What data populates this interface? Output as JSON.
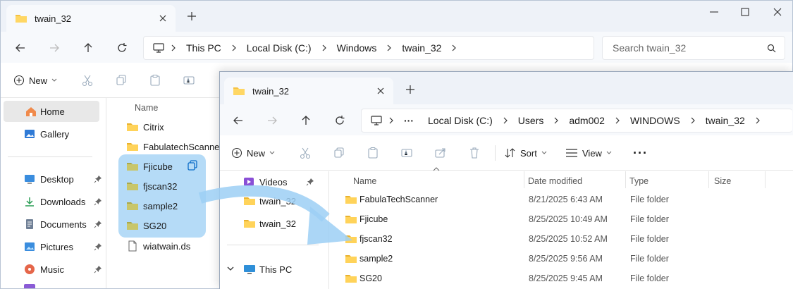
{
  "back_window": {
    "tab_title": "twain_32",
    "breadcrumb": [
      "This PC",
      "Local Disk (C:)",
      "Windows",
      "twain_32"
    ],
    "search_placeholder": "Search twain_32",
    "toolbar": {
      "new_label": "New"
    },
    "nav": [
      {
        "label": "Home",
        "icon": "home-icon",
        "pinned": false
      },
      {
        "label": "Gallery",
        "icon": "gallery-icon",
        "pinned": false
      },
      {
        "label": "Desktop",
        "icon": "desktop-icon",
        "pinned": true
      },
      {
        "label": "Downloads",
        "icon": "download-icon",
        "pinned": true
      },
      {
        "label": "Documents",
        "icon": "documents-icon",
        "pinned": true
      },
      {
        "label": "Pictures",
        "icon": "pictures-icon",
        "pinned": true
      },
      {
        "label": "Music",
        "icon": "music-icon",
        "pinned": true
      }
    ],
    "column_name": "Name",
    "files": [
      {
        "name": "Citrix",
        "type": "folder",
        "selected": false
      },
      {
        "name": "FabulatechScanner",
        "type": "folder",
        "selected": false
      },
      {
        "name": "Fjicube",
        "type": "folder",
        "selected": true
      },
      {
        "name": "fjscan32",
        "type": "folder",
        "selected": true
      },
      {
        "name": "sample2",
        "type": "folder",
        "selected": true
      },
      {
        "name": "SG20",
        "type": "folder",
        "selected": true
      },
      {
        "name": "wiatwain.ds",
        "type": "file",
        "selected": false
      }
    ]
  },
  "front_window": {
    "tab_title": "twain_32",
    "breadcrumb": [
      "···",
      "Local Disk (C:)",
      "Users",
      "adm002",
      "WINDOWS",
      "twain_32"
    ],
    "toolbar": {
      "new_label": "New",
      "sort_label": "Sort",
      "view_label": "View",
      "more_label": "···"
    },
    "nav": [
      {
        "label": "Videos",
        "icon": "videos-icon",
        "pinned": true
      },
      {
        "label": "twain_32",
        "icon": "folder-icon",
        "pinned": false
      },
      {
        "label": "twain_32",
        "icon": "folder-icon",
        "pinned": false
      },
      {
        "label": "This PC",
        "icon": "this-pc-icon",
        "pinned": false,
        "expanded": true
      }
    ],
    "columns": [
      "Name",
      "Date modified",
      "Type",
      "Size"
    ],
    "files": [
      {
        "name": "FabulaTechScanner",
        "date": "8/21/2025 6:43 AM",
        "type": "File folder",
        "size": ""
      },
      {
        "name": "Fjicube",
        "date": "8/25/2025 10:49 AM",
        "type": "File folder",
        "size": ""
      },
      {
        "name": "fjscan32",
        "date": "8/25/2025 10:52 AM",
        "type": "File folder",
        "size": ""
      },
      {
        "name": "sample2",
        "date": "8/25/2025 9:56 AM",
        "type": "File folder",
        "size": ""
      },
      {
        "name": "SG20",
        "date": "8/25/2025 9:45 AM",
        "type": "File folder",
        "size": ""
      }
    ]
  },
  "colors": {
    "accent": "#0067c0",
    "selection": "#cce4f7",
    "drag_arrow": "#9ccff5",
    "folder": "#f5c242"
  }
}
